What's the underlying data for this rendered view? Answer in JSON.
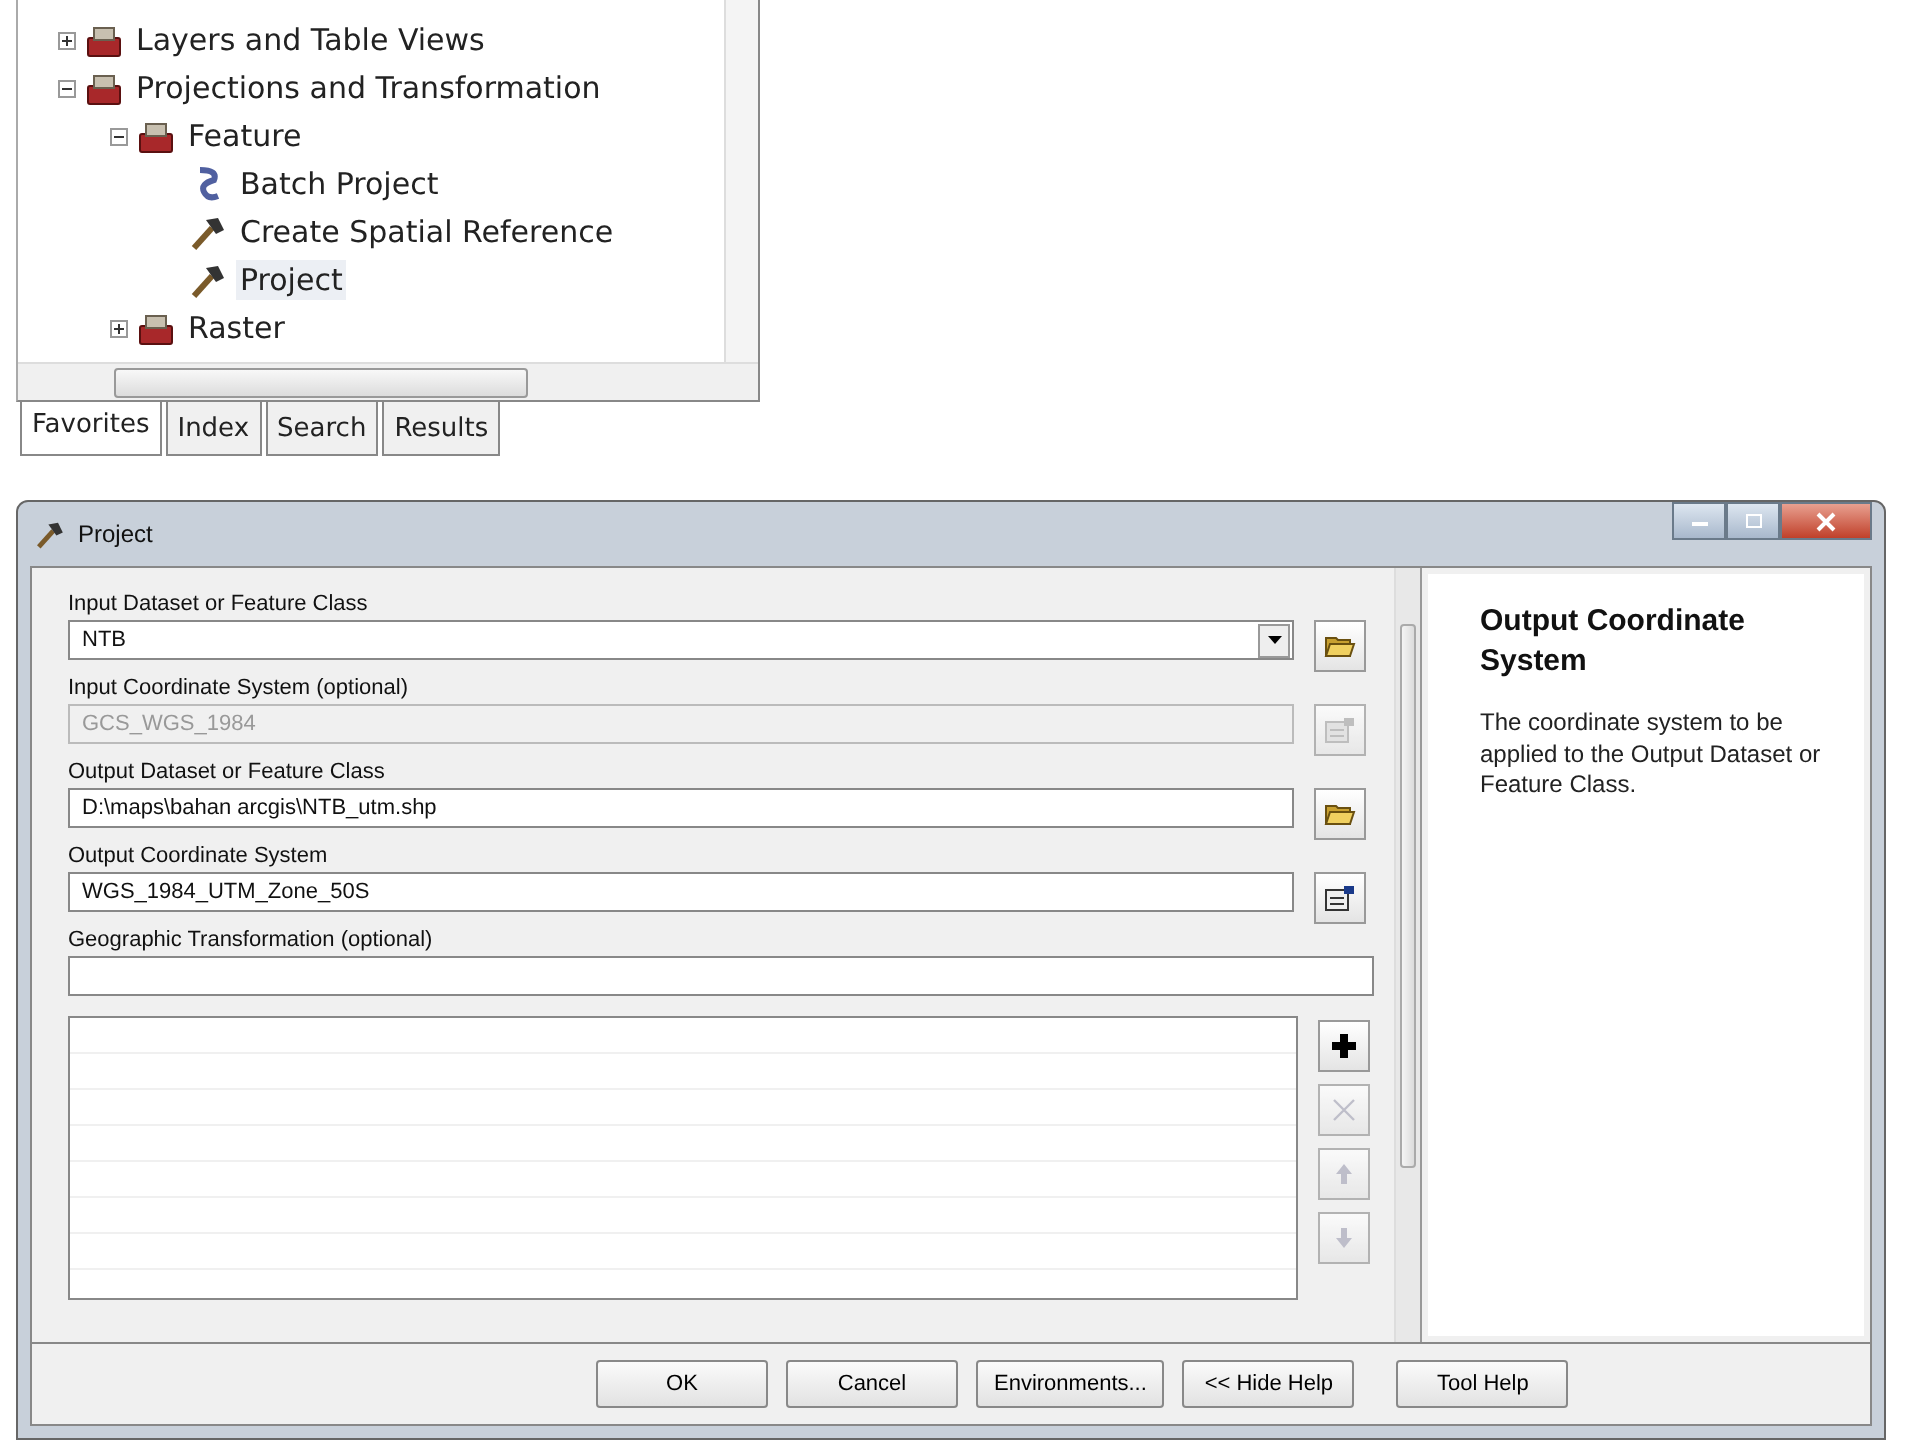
{
  "catalog": {
    "tree": [
      {
        "label": "Layers and Table Views",
        "kind": "toolbox",
        "expanded": false,
        "selected": false
      },
      {
        "label": "Projections and Transformation",
        "kind": "toolbox",
        "expanded": true,
        "selected": false,
        "children": [
          {
            "label": "Feature",
            "kind": "toolbox",
            "expanded": true,
            "selected": false,
            "children": [
              {
                "label": "Batch Project",
                "kind": "script",
                "selected": false
              },
              {
                "label": "Create Spatial Reference",
                "kind": "tool",
                "selected": false
              },
              {
                "label": "Project",
                "kind": "tool",
                "selected": true
              }
            ]
          },
          {
            "label": "Raster",
            "kind": "toolbox",
            "expanded": false,
            "selected": false
          }
        ]
      }
    ],
    "tabs": [
      {
        "label": "Favorites",
        "selected": true
      },
      {
        "label": "Index",
        "selected": false
      },
      {
        "label": "Search",
        "selected": false
      },
      {
        "label": "Results",
        "selected": false
      }
    ]
  },
  "dialog": {
    "title": "Project",
    "params": [
      {
        "label": "Input Dataset or Feature Class",
        "kind": "combo",
        "value": "NTB",
        "button": {
          "kind": "folder"
        },
        "disabled": false
      },
      {
        "label": "Input Coordinate System (optional)",
        "kind": "text",
        "value": "GCS_WGS_1984",
        "button": {
          "kind": "properties"
        },
        "disabled": true
      },
      {
        "label": "Output Dataset or Feature Class",
        "kind": "text",
        "value": "D:\\maps\\bahan arcgis\\NTB_utm.shp",
        "button": {
          "kind": "folder"
        },
        "disabled": false
      },
      {
        "label": "Output Coordinate System",
        "kind": "text",
        "value": "WGS_1984_UTM_Zone_50S",
        "button": {
          "kind": "properties"
        },
        "disabled": false
      },
      {
        "label": "Geographic Transformation (optional)",
        "kind": "list",
        "disabled": false
      }
    ],
    "list_buttons": [
      {
        "kind": "add",
        "disabled": false
      },
      {
        "kind": "remove",
        "disabled": true
      },
      {
        "kind": "up",
        "disabled": true
      },
      {
        "kind": "down",
        "disabled": true
      }
    ],
    "help": {
      "title": "Output Coordinate System",
      "text": "The coordinate system to be applied to the Output Dataset or Feature Class."
    },
    "buttons": [
      "OK",
      "Cancel",
      "Environments...",
      "<< Hide Help",
      "Tool Help"
    ]
  }
}
